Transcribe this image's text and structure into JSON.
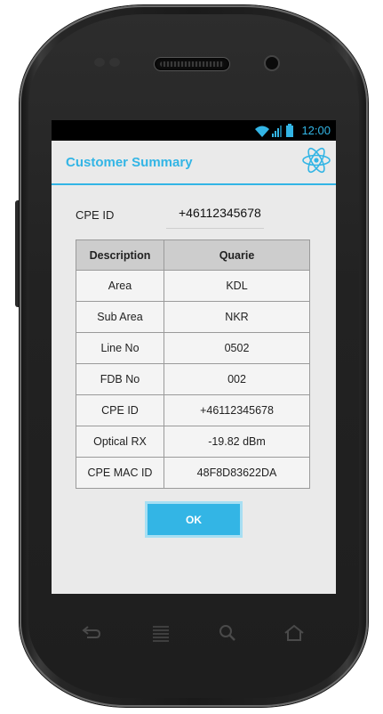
{
  "status_bar": {
    "time": "12:00",
    "accent_color": "#33b5e5",
    "icons": [
      "wifi-icon",
      "signal-icon",
      "battery-icon"
    ]
  },
  "dialog": {
    "title": "Customer Summary",
    "header_icon": "atom-icon",
    "cpe_label": "CPE ID",
    "cpe_value": "+46112345678",
    "table": {
      "headers": [
        "Description",
        "Quarie"
      ],
      "rows": [
        [
          "Area",
          "KDL"
        ],
        [
          "Sub Area",
          "NKR"
        ],
        [
          "Line No",
          "0502"
        ],
        [
          "FDB No",
          "002"
        ],
        [
          "CPE ID",
          "+46112345678"
        ],
        [
          "Optical RX",
          "-19.82 dBm"
        ],
        [
          "CPE MAC ID",
          "48F8D83622DA"
        ]
      ]
    },
    "ok_label": "OK"
  },
  "nav_keys": [
    "back-icon",
    "menu-icon",
    "search-icon",
    "home-icon"
  ]
}
